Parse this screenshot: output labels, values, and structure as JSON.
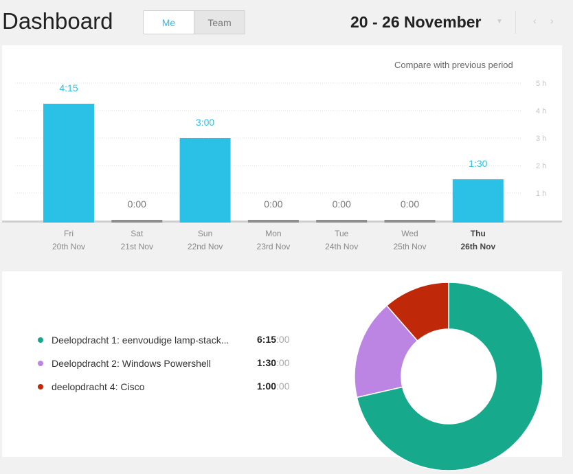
{
  "header": {
    "title": "Dashboard",
    "toggle": {
      "me": "Me",
      "team": "Team",
      "active": "me"
    },
    "period": "20 - 26 November",
    "icons": {
      "caret": "caret-down-icon",
      "prev": "chevron-left-icon",
      "next": "chevron-right-icon"
    }
  },
  "chart_link": "Compare with previous period",
  "chart_data": {
    "type": "bar",
    "categories": [
      "Fri",
      "Sat",
      "Sun",
      "Mon",
      "Tue",
      "Wed",
      "Thu"
    ],
    "dates": [
      "20th Nov",
      "21st Nov",
      "22nd Nov",
      "23rd Nov",
      "24th Nov",
      "25th Nov",
      "26th Nov"
    ],
    "labels": [
      "4:15",
      "0:00",
      "3:00",
      "0:00",
      "0:00",
      "0:00",
      "1:30"
    ],
    "values": [
      4.25,
      0,
      3,
      0,
      0,
      0,
      1.5
    ],
    "ylim": [
      0,
      5
    ],
    "yticks": [
      "1 h",
      "2 h",
      "3 h",
      "4 h",
      "5 h"
    ],
    "highlight_index": 6,
    "bar_color": "#2bc0e6",
    "zero_color": "#8e8e8e"
  },
  "breakdown": {
    "items": [
      {
        "name": "Deelopdracht 1: eenvoudige lamp-stack...",
        "main": "6:15",
        "sec": ":00",
        "color": "#16a98c",
        "value": 6.25
      },
      {
        "name": "Deelopdracht 2: Windows Powershell",
        "main": "1:30",
        "sec": ":00",
        "color": "#bd85e3",
        "value": 1.5
      },
      {
        "name": "deelopdracht 4: Cisco",
        "main": "1:00",
        "sec": ":00",
        "color": "#c0280a",
        "value": 1.0
      }
    ]
  }
}
